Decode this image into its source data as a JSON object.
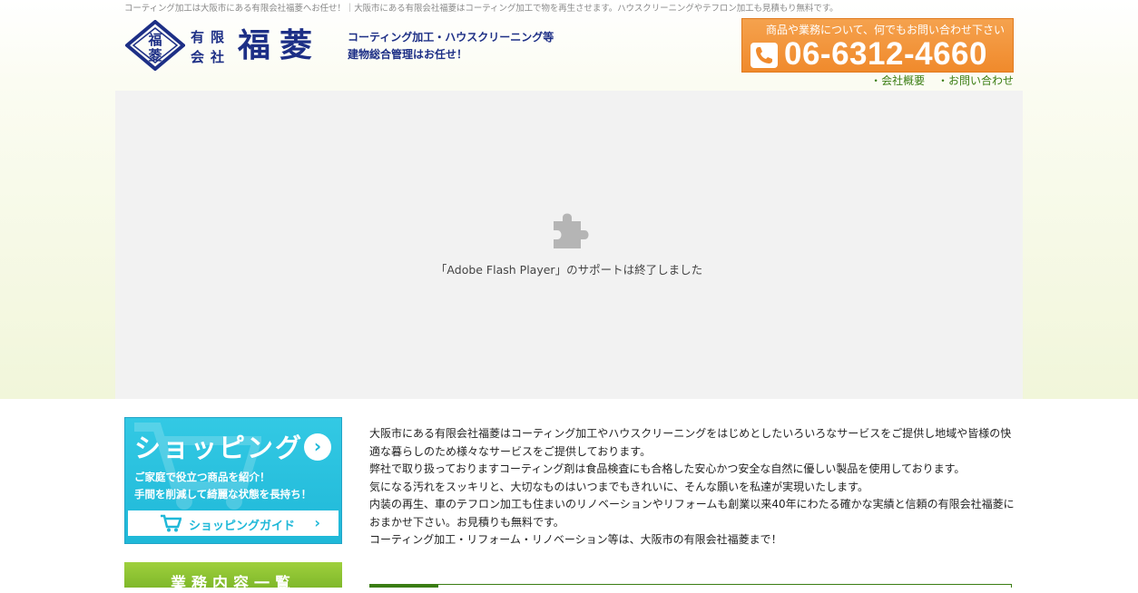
{
  "header": {
    "tagline": "コーティング加工は大阪市にある有限会社福菱へお任せ！｜大阪市にある有限会社福菱はコーティング加工で物を再生させます。ハウスクリーニングやテフロン加工も見積もり無料です。",
    "logo": {
      "emblem_chars": [
        "福",
        "菱"
      ],
      "company_type": [
        "有限",
        "会社"
      ],
      "company_name": "福菱"
    },
    "catch_lines": [
      "コーティング加工・ハウスクリーニング等",
      "建物総合管理はお任せ！"
    ],
    "phone": {
      "caption": "商品や業務について、何でもお問い合わせ下さい",
      "number": "06-6312-4660",
      "icon": "phone-icon"
    },
    "links": [
      "・会社概要",
      "・お問い合わせ"
    ]
  },
  "flash": {
    "icon": "puzzle-piece-icon",
    "message": "「Adobe Flash Player」のサポートは終了しました"
  },
  "sidebar": {
    "shopping": {
      "title": "ショッピング",
      "sub_lines": [
        "ご家庭で役立つ商品を紹介！",
        "手間を削減して綺麗な状態を長持ち！"
      ],
      "guide_label": "ショッピングガイド",
      "guide_icon": "cart-icon",
      "arrow": "›"
    },
    "services_title": "業務内容一覧"
  },
  "intro": {
    "paragraphs": [
      "大阪市にある有限会社福菱はコーティング加工やハウスクリーニングをはじめとしたいろいろなサービスをご提供し地域や皆様の快適な暮らしのため様々なサービスをご提供しております。",
      "弊社で取り扱っておりますコーティング剤は食品検査にも合格した安心かつ安全な自然に優しい製品を使用しております。",
      "気になる汚れをスッキリと、大切なものはいつまでもきれいに、そんな願いを私達が実現いたします。",
      "内装の再生、車のテフロン加工も住まいのリノベーションやリフォームも創業以来40年にわたる確かな実績と信頼の有限会社福菱におまかせ下さい。お見積りも無料です。",
      "コーティング加工・リフォーム・リノベーション等は、大阪市の有限会社福菱まで！"
    ]
  },
  "colors": {
    "brand_blue": "#1d2f86",
    "phone_orange": "#f08a2c",
    "link_green": "#3a7d12",
    "shop_cyan": "#1fb8d8",
    "service_green": "#8cc232"
  }
}
